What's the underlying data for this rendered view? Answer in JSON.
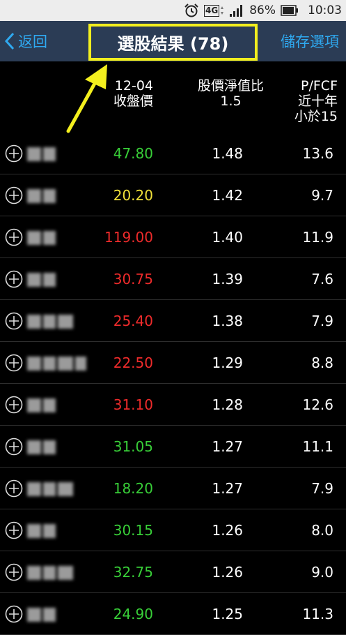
{
  "status_bar": {
    "network": "4G",
    "battery": "86%",
    "time": "10:03"
  },
  "nav": {
    "back_label": "返回",
    "title": "選股結果 (78)",
    "save_label": "儲存選項"
  },
  "colors": {
    "up": "#ee2b2b",
    "down": "#38cf38",
    "flat": "#f0e03a",
    "annotation": "#f3ef1e",
    "link": "#2fa9f0",
    "navbar": "#2b3c55"
  },
  "columns": {
    "price": [
      "12-04",
      "收盤價"
    ],
    "pb": [
      "股價淨值比",
      "1.5"
    ],
    "pfcf": [
      "P/FCF",
      "近十年",
      "小於15"
    ]
  },
  "rows": [
    {
      "price": "47.80",
      "pb": "1.48",
      "pfcf": "13.6",
      "trend": "down",
      "name_blocks": 2
    },
    {
      "price": "20.20",
      "pb": "1.42",
      "pfcf": "9.7",
      "trend": "flat",
      "name_blocks": 2
    },
    {
      "price": "119.00",
      "pb": "1.40",
      "pfcf": "11.9",
      "trend": "up",
      "name_blocks": 2
    },
    {
      "price": "30.75",
      "pb": "1.39",
      "pfcf": "7.6",
      "trend": "up",
      "name_blocks": 2
    },
    {
      "price": "25.40",
      "pb": "1.38",
      "pfcf": "7.9",
      "trend": "up",
      "name_blocks": 3
    },
    {
      "price": "22.50",
      "pb": "1.29",
      "pfcf": "8.8",
      "trend": "up",
      "name_blocks": 4
    },
    {
      "price": "31.10",
      "pb": "1.28",
      "pfcf": "12.6",
      "trend": "up",
      "name_blocks": 2
    },
    {
      "price": "31.05",
      "pb": "1.27",
      "pfcf": "11.1",
      "trend": "down",
      "name_blocks": 2
    },
    {
      "price": "18.20",
      "pb": "1.27",
      "pfcf": "7.9",
      "trend": "down",
      "name_blocks": 3
    },
    {
      "price": "30.15",
      "pb": "1.26",
      "pfcf": "8.0",
      "trend": "down",
      "name_blocks": 2
    },
    {
      "price": "32.75",
      "pb": "1.26",
      "pfcf": "9.0",
      "trend": "down",
      "name_blocks": 3
    },
    {
      "price": "24.90",
      "pb": "1.25",
      "pfcf": "11.3",
      "trend": "down",
      "name_blocks": 2
    }
  ]
}
